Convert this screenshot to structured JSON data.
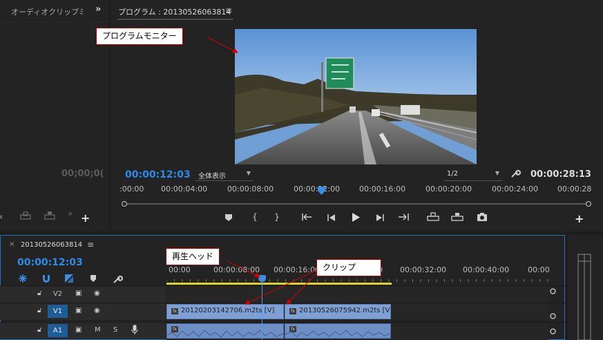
{
  "left_panel": {
    "title": "オーディオクリップミ",
    "more": "»",
    "timecode": "00;00;0(",
    "plus": "+"
  },
  "program_monitor": {
    "title": "プログラム : 20130526063814",
    "menu": "≡",
    "timecode": "00:00:12:03",
    "fit": "全体表示",
    "resolution": "1/2",
    "duration": "00:00:28:13",
    "ruler_labels": [
      ":00:00",
      "00:00:04:00",
      "00:00:08:00",
      "00:00:12:00",
      "00:00:16:00",
      "00:00:20:00",
      "00:00:24:00",
      "00:00:28"
    ],
    "playhead_fraction": 0.425,
    "plus": "+"
  },
  "timeline": {
    "close": "×",
    "title": "20130526063814",
    "menu": "≡",
    "timecode": "00:00:12:03",
    "ruler_labels": [
      "00:00",
      "00:00:08:00",
      "00:00:16:00",
      "00:00:24:00",
      "00:00:32:00",
      "00:00:40:00",
      "00:00"
    ],
    "tracks": {
      "v2": "V2",
      "v1": "V1",
      "a1": "A1",
      "mute": "M",
      "solo": "S"
    },
    "clips": {
      "v1_first": "20120203142706.m2ts [V]",
      "v1_second": "20130526075942.m2ts [V",
      "fx": "fx"
    }
  },
  "annotations": {
    "program_monitor": "プログラムモニター",
    "playhead": "再生ヘッド",
    "clip": "クリップ"
  },
  "colors": {
    "accent": "#2d8ceb",
    "callout_border": "#c00000",
    "clip": "#7fa0d4",
    "work_area": "#e3d226"
  }
}
